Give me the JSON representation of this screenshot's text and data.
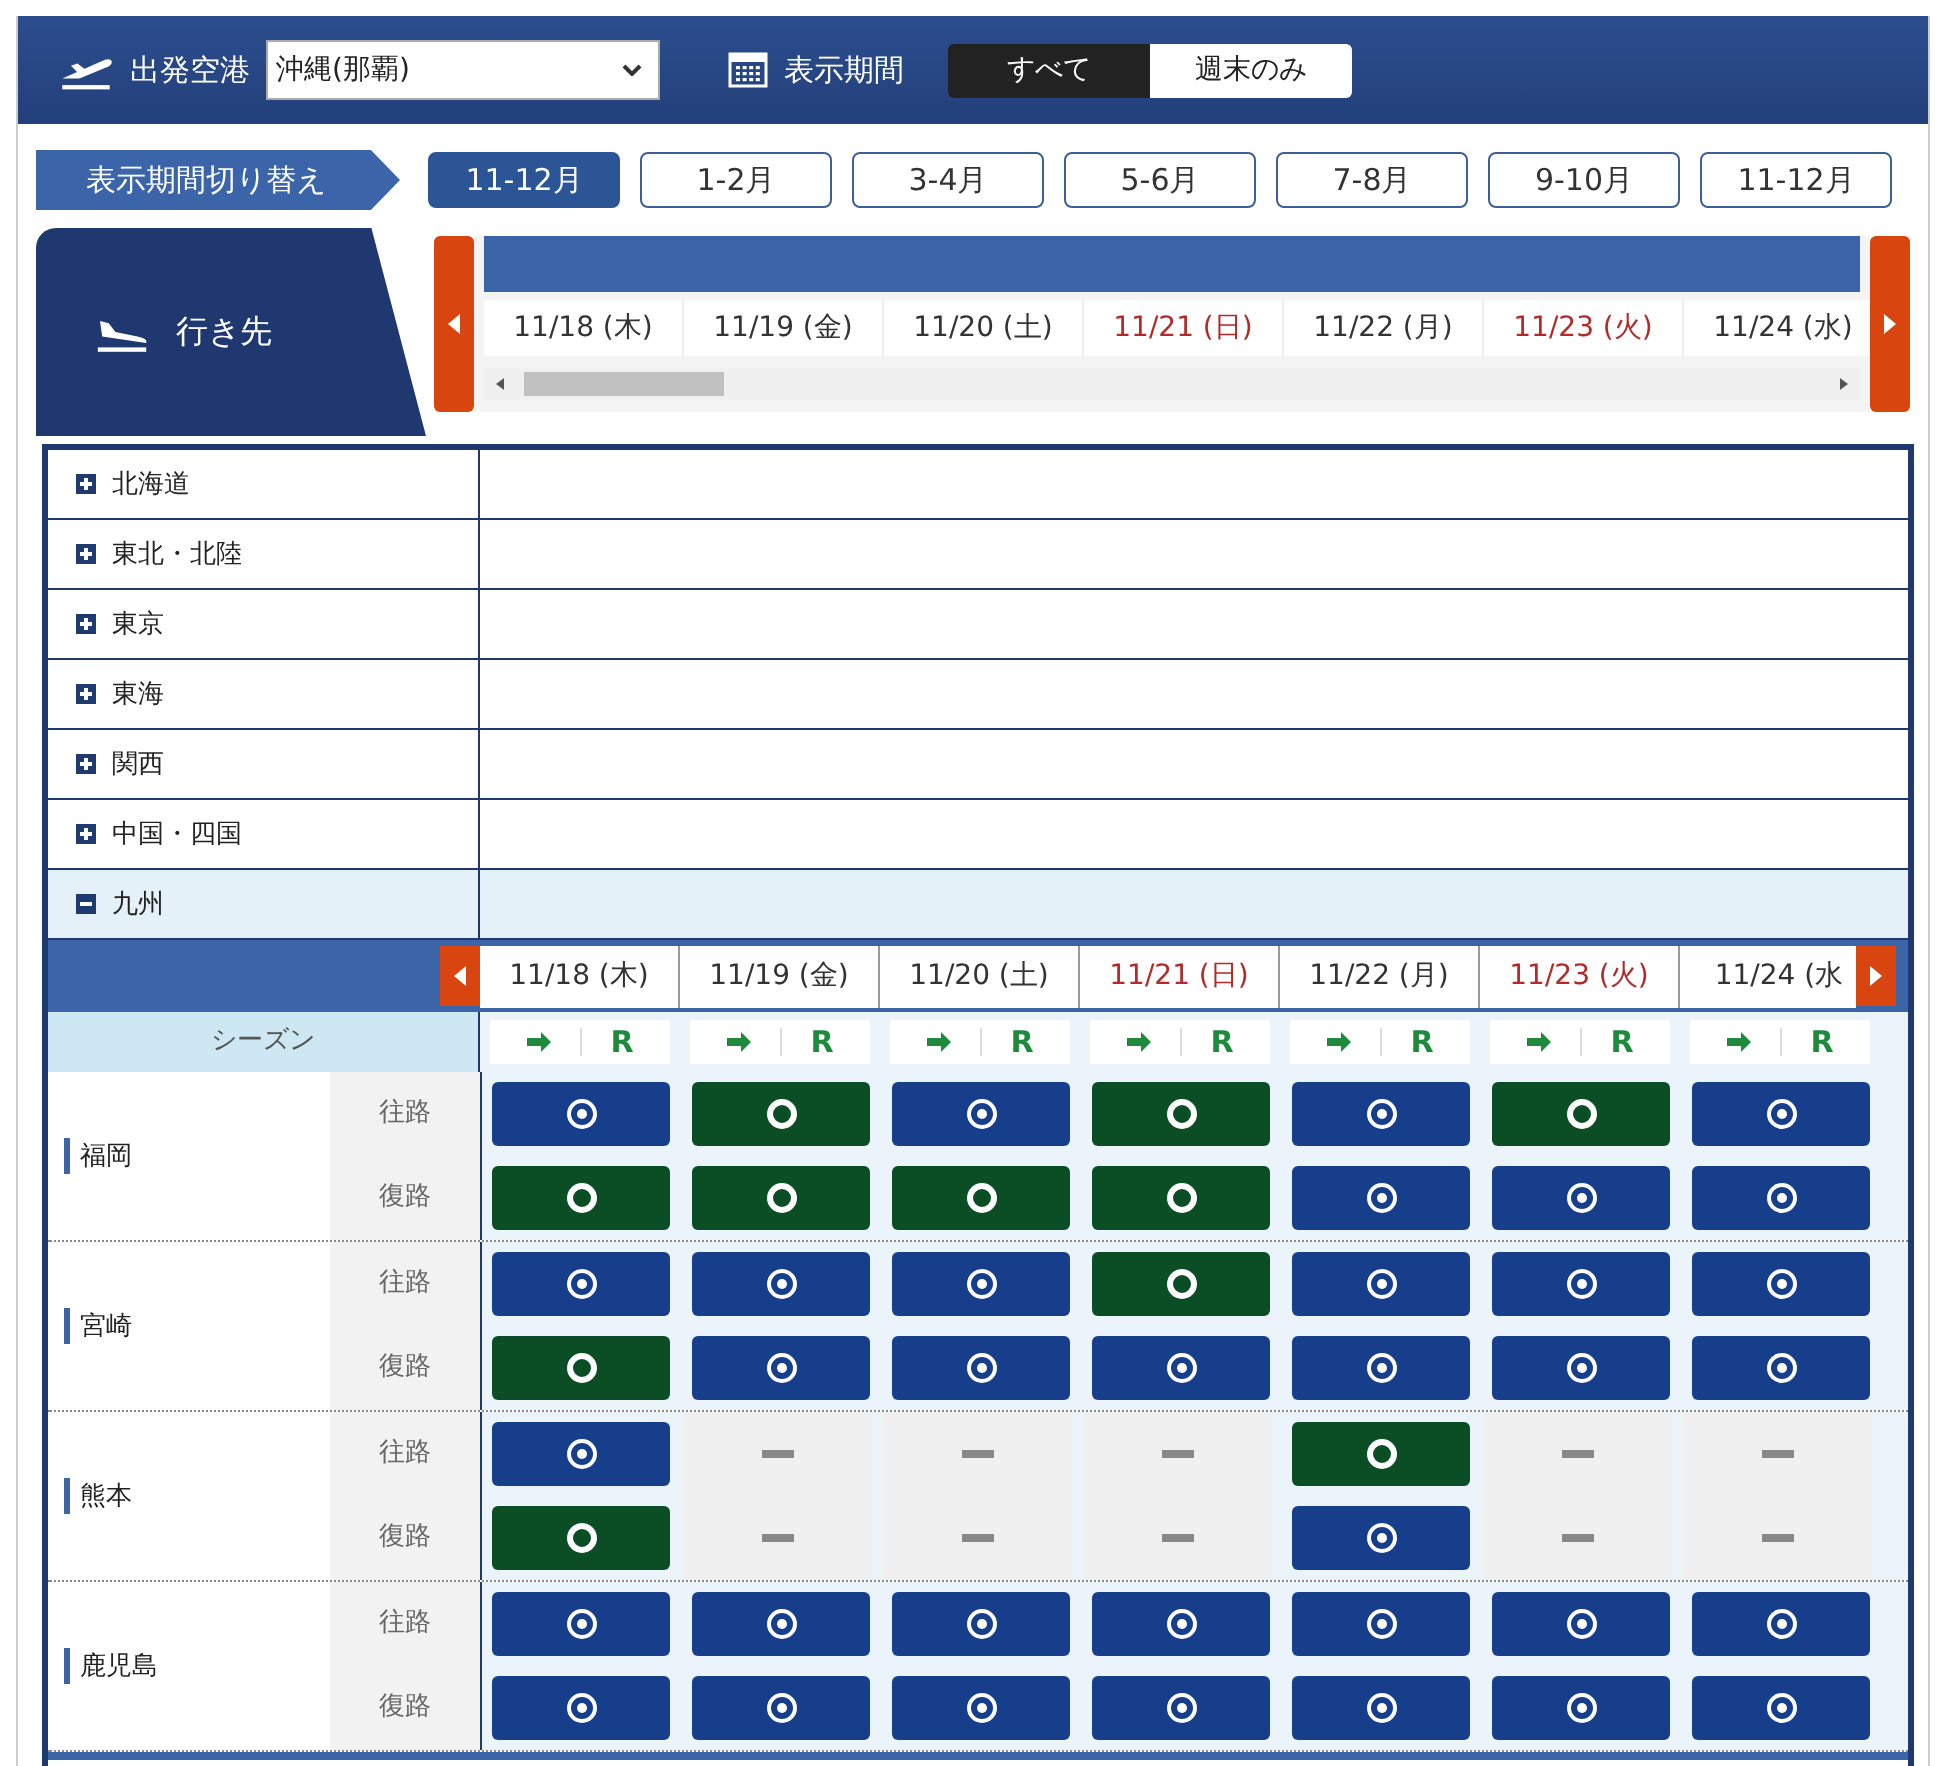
{
  "header": {
    "departure_label": "出発空港",
    "departure_value": "沖縄(那覇)",
    "period_label": "表示期間",
    "period_options": [
      {
        "label": "すべて",
        "selected": true
      },
      {
        "label": "週末のみ",
        "selected": false
      }
    ]
  },
  "period_switch": {
    "label": "表示期間切り替え",
    "tabs": [
      {
        "label": "11-12月",
        "selected": true
      },
      {
        "label": "1-2月",
        "selected": false
      },
      {
        "label": "3-4月",
        "selected": false
      },
      {
        "label": "5-6月",
        "selected": false
      },
      {
        "label": "7-8月",
        "selected": false
      },
      {
        "label": "9-10月",
        "selected": false
      },
      {
        "label": "11-12月",
        "selected": false
      }
    ]
  },
  "destination_tab": {
    "label": "行き先"
  },
  "top_dates": [
    {
      "label": "11/18 (木)",
      "holiday": false
    },
    {
      "label": "11/19 (金)",
      "holiday": false
    },
    {
      "label": "11/20 (土)",
      "holiday": false
    },
    {
      "label": "11/21 (日)",
      "holiday": true
    },
    {
      "label": "11/22 (月)",
      "holiday": false
    },
    {
      "label": "11/23 (火)",
      "holiday": true
    },
    {
      "label": "11/24 (水)",
      "holiday": false
    }
  ],
  "regions": [
    {
      "name": "北海道",
      "expanded": false
    },
    {
      "name": "東北・北陸",
      "expanded": false
    },
    {
      "name": "東京",
      "expanded": false
    },
    {
      "name": "東海",
      "expanded": false
    },
    {
      "name": "関西",
      "expanded": false
    },
    {
      "name": "中国・四国",
      "expanded": false
    },
    {
      "name": "九州",
      "expanded": true
    }
  ],
  "section": {
    "dates": [
      {
        "label": "11/18 (木)",
        "holiday": false
      },
      {
        "label": "11/19 (金)",
        "holiday": false
      },
      {
        "label": "11/20 (土)",
        "holiday": false
      },
      {
        "label": "11/21 (日)",
        "holiday": true
      },
      {
        "label": "11/22 (月)",
        "holiday": false
      },
      {
        "label": "11/23 (火)",
        "holiday": true
      },
      {
        "label": "11/24 (水",
        "holiday": false
      }
    ],
    "season_label": "シーズン",
    "column_headers": [
      {
        "label": "R"
      },
      {
        "label": "R"
      },
      {
        "label": "R"
      },
      {
        "label": "R"
      },
      {
        "label": "R"
      },
      {
        "label": "R"
      },
      {
        "label": "R"
      }
    ]
  },
  "routes": [
    {
      "name": "福岡",
      "legs": [
        {
          "label": "往路",
          "cells": [
            {
              "kind": "bullseye"
            },
            {
              "kind": "ring"
            },
            {
              "kind": "bullseye"
            },
            {
              "kind": "ring"
            },
            {
              "kind": "bullseye"
            },
            {
              "kind": "ring"
            },
            {
              "kind": "bullseye"
            }
          ]
        },
        {
          "label": "復路",
          "cells": [
            {
              "kind": "ring"
            },
            {
              "kind": "ring"
            },
            {
              "kind": "ring"
            },
            {
              "kind": "ring"
            },
            {
              "kind": "bullseye"
            },
            {
              "kind": "bullseye"
            },
            {
              "kind": "bullseye"
            }
          ]
        }
      ]
    },
    {
      "name": "宮崎",
      "legs": [
        {
          "label": "往路",
          "cells": [
            {
              "kind": "bullseye"
            },
            {
              "kind": "bullseye"
            },
            {
              "kind": "bullseye"
            },
            {
              "kind": "ring"
            },
            {
              "kind": "bullseye"
            },
            {
              "kind": "bullseye"
            },
            {
              "kind": "bullseye"
            }
          ]
        },
        {
          "label": "復路",
          "cells": [
            {
              "kind": "ring"
            },
            {
              "kind": "bullseye"
            },
            {
              "kind": "bullseye"
            },
            {
              "kind": "bullseye"
            },
            {
              "kind": "bullseye"
            },
            {
              "kind": "bullseye"
            },
            {
              "kind": "bullseye"
            }
          ]
        }
      ]
    },
    {
      "name": "熊本",
      "legs": [
        {
          "label": "往路",
          "cells": [
            {
              "kind": "bullseye"
            },
            {
              "kind": "dash"
            },
            {
              "kind": "dash"
            },
            {
              "kind": "dash"
            },
            {
              "kind": "ring"
            },
            {
              "kind": "dash"
            },
            {
              "kind": "dash"
            }
          ]
        },
        {
          "label": "復路",
          "cells": [
            {
              "kind": "ring"
            },
            {
              "kind": "dash"
            },
            {
              "kind": "dash"
            },
            {
              "kind": "dash"
            },
            {
              "kind": "bullseye"
            },
            {
              "kind": "dash"
            },
            {
              "kind": "dash"
            }
          ]
        }
      ]
    },
    {
      "name": "鹿児島",
      "legs": [
        {
          "label": "往路",
          "cells": [
            {
              "kind": "bullseye"
            },
            {
              "kind": "bullseye"
            },
            {
              "kind": "bullseye"
            },
            {
              "kind": "bullseye"
            },
            {
              "kind": "bullseye"
            },
            {
              "kind": "bullseye"
            },
            {
              "kind": "bullseye"
            }
          ]
        },
        {
          "label": "復路",
          "cells": [
            {
              "kind": "bullseye"
            },
            {
              "kind": "bullseye"
            },
            {
              "kind": "bullseye"
            },
            {
              "kind": "bullseye"
            },
            {
              "kind": "bullseye"
            },
            {
              "kind": "bullseye"
            },
            {
              "kind": "bullseye"
            }
          ]
        }
      ]
    }
  ]
}
